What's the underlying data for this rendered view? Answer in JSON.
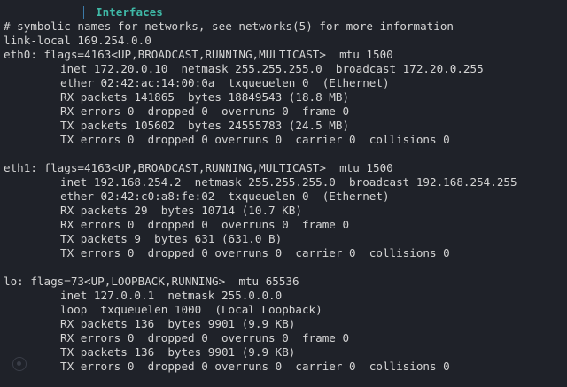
{
  "header": {
    "title": "Interfaces"
  },
  "terminal": {
    "lines": [
      "# symbolic names for networks, see networks(5) for more information",
      "link-local 169.254.0.0",
      "eth0: flags=4163<UP,BROADCAST,RUNNING,MULTICAST>  mtu 1500",
      "inet 172.20.0.10  netmask 255.255.255.0  broadcast 172.20.0.255",
      "ether 02:42:ac:14:00:0a  txqueuelen 0  (Ethernet)",
      "RX packets 141865  bytes 18849543 (18.8 MB)",
      "RX errors 0  dropped 0  overruns 0  frame 0",
      "TX packets 105602  bytes 24555783 (24.5 MB)",
      "TX errors 0  dropped 0 overruns 0  carrier 0  collisions 0",
      "eth1: flags=4163<UP,BROADCAST,RUNNING,MULTICAST>  mtu 1500",
      "inet 192.168.254.2  netmask 255.255.255.0  broadcast 192.168.254.255",
      "ether 02:42:c0:a8:fe:02  txqueuelen 0  (Ethernet)",
      "RX packets 29  bytes 10714 (10.7 KB)",
      "RX errors 0  dropped 0  overruns 0  frame 0",
      "TX packets 9  bytes 631 (631.0 B)",
      "TX errors 0  dropped 0 overruns 0  carrier 0  collisions 0",
      "lo: flags=73<UP,LOOPBACK,RUNNING>  mtu 65536",
      "inet 127.0.0.1  netmask 255.0.0.0",
      "loop  txqueuelen 1000  (Local Loopback)",
      "RX packets 136  bytes 9901 (9.9 KB)",
      "RX errors 0  dropped 0  overruns 0  frame 0",
      "TX packets 136  bytes 9901 (9.9 KB)",
      "TX errors 0  dropped 0 overruns 0  carrier 0  collisions 0"
    ]
  }
}
